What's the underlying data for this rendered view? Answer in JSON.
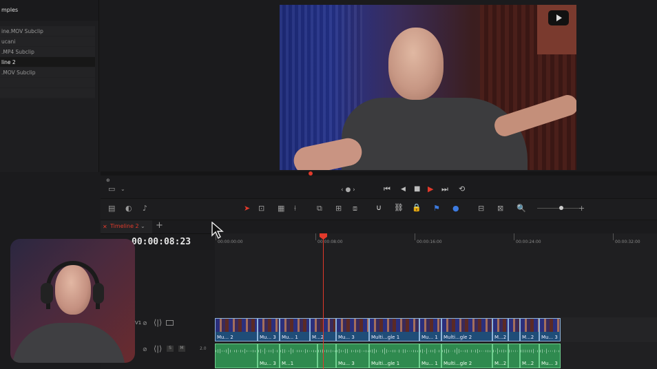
{
  "media_pool": {
    "header": "mples",
    "items": [
      {
        "label": "ine.MOV Subclip",
        "selected": false
      },
      {
        "label": "ucani",
        "selected": false
      },
      {
        "label": ".MP4 Subclip",
        "selected": false
      },
      {
        "label": "line 2",
        "selected": true
      },
      {
        "label": ".MOV Subclip",
        "selected": false
      }
    ]
  },
  "viewer": {
    "scrub_zoom_label": "⊕",
    "transport": {
      "jog_label": "‹ ● ›",
      "first_icon": "⏮",
      "prev_icon": "◀",
      "stop_icon": "■",
      "play_icon": "▶",
      "last_icon": "⏭",
      "loop_icon": "⟲"
    }
  },
  "timeline": {
    "tab_label": "Timeline 2",
    "timecode": "00:00:08:23",
    "ruler": [
      "00:00:00:00",
      "00:00:08:00",
      "00:00:16:00",
      "00:00:24:00",
      "00:00:32:00"
    ],
    "track_labels": {
      "v1": "V1",
      "a1": "A1",
      "a1_level": "2.0",
      "a1_num": "1"
    },
    "video_clips": [
      "Mu... 2",
      "Mu... 3",
      "Mu... 1",
      "M...2",
      "Mu... 3",
      "Multi...gle 1",
      "Mu... 1",
      "Multi...gle 2",
      "M...2",
      "M...2",
      "Mu... 3"
    ],
    "audio_clips": [
      "Mu... 3",
      "M...1",
      "Mu... 3",
      "Multi...gle 1",
      "Mu... 1",
      "Multi...gle 2",
      "M...2",
      "M...2",
      "Mu... 3"
    ]
  },
  "colors": {
    "playhead": "#e23a2b",
    "video_clip": "#1f4d78",
    "audio_clip": "#2f8a4f"
  },
  "icons": [
    "crop-icon",
    "chevron-down-icon",
    "first-frame-icon",
    "prev-frame-icon",
    "stop-icon",
    "play-icon",
    "last-frame-icon",
    "loop-icon",
    "select-tool-icon",
    "trim-tool-icon",
    "blade-tool-icon",
    "snap-icon",
    "link-icon",
    "lock-icon",
    "flag-icon",
    "marker-icon",
    "zoom-icon",
    "add-tab-icon"
  ]
}
